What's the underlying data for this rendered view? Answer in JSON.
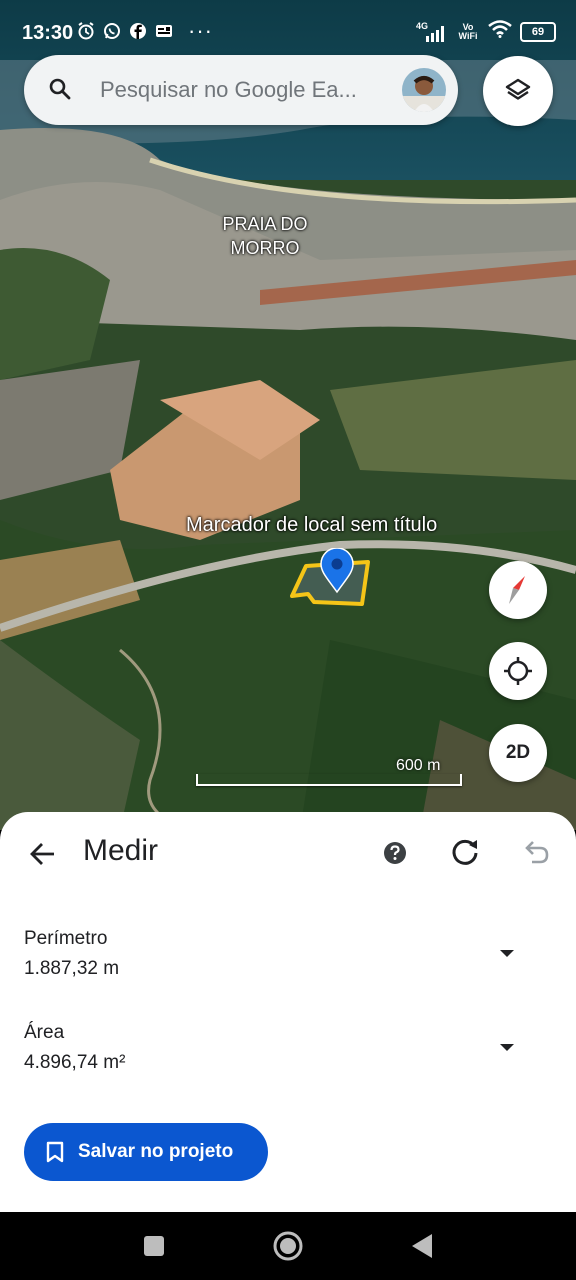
{
  "status_bar": {
    "time": "13:30",
    "network_label": "4G",
    "vowifi_label_top": "Vo",
    "vowifi_label_bottom": "WiFi",
    "battery": "69",
    "left_icons": [
      "alarm-icon",
      "whatsapp-icon",
      "facebook-icon",
      "gallery-icon"
    ],
    "overflow": "···"
  },
  "search": {
    "placeholder": "Pesquisar no Google Ea..."
  },
  "map": {
    "place_label": "PRAIA DO MORRO",
    "marker_label": "Marcador de local sem título",
    "scale_label": "600 m",
    "view_mode_button": "2D"
  },
  "measure_panel": {
    "title": "Medir",
    "perimeter_label": "Perímetro",
    "perimeter_value": "1.887,32 m",
    "area_label": "Área",
    "area_value": "4.896,74 m²",
    "save_button": "Salvar no projeto"
  },
  "colors": {
    "accent": "#0b57d0",
    "polygon": "#f5c518",
    "marker": "#1a73e8"
  }
}
